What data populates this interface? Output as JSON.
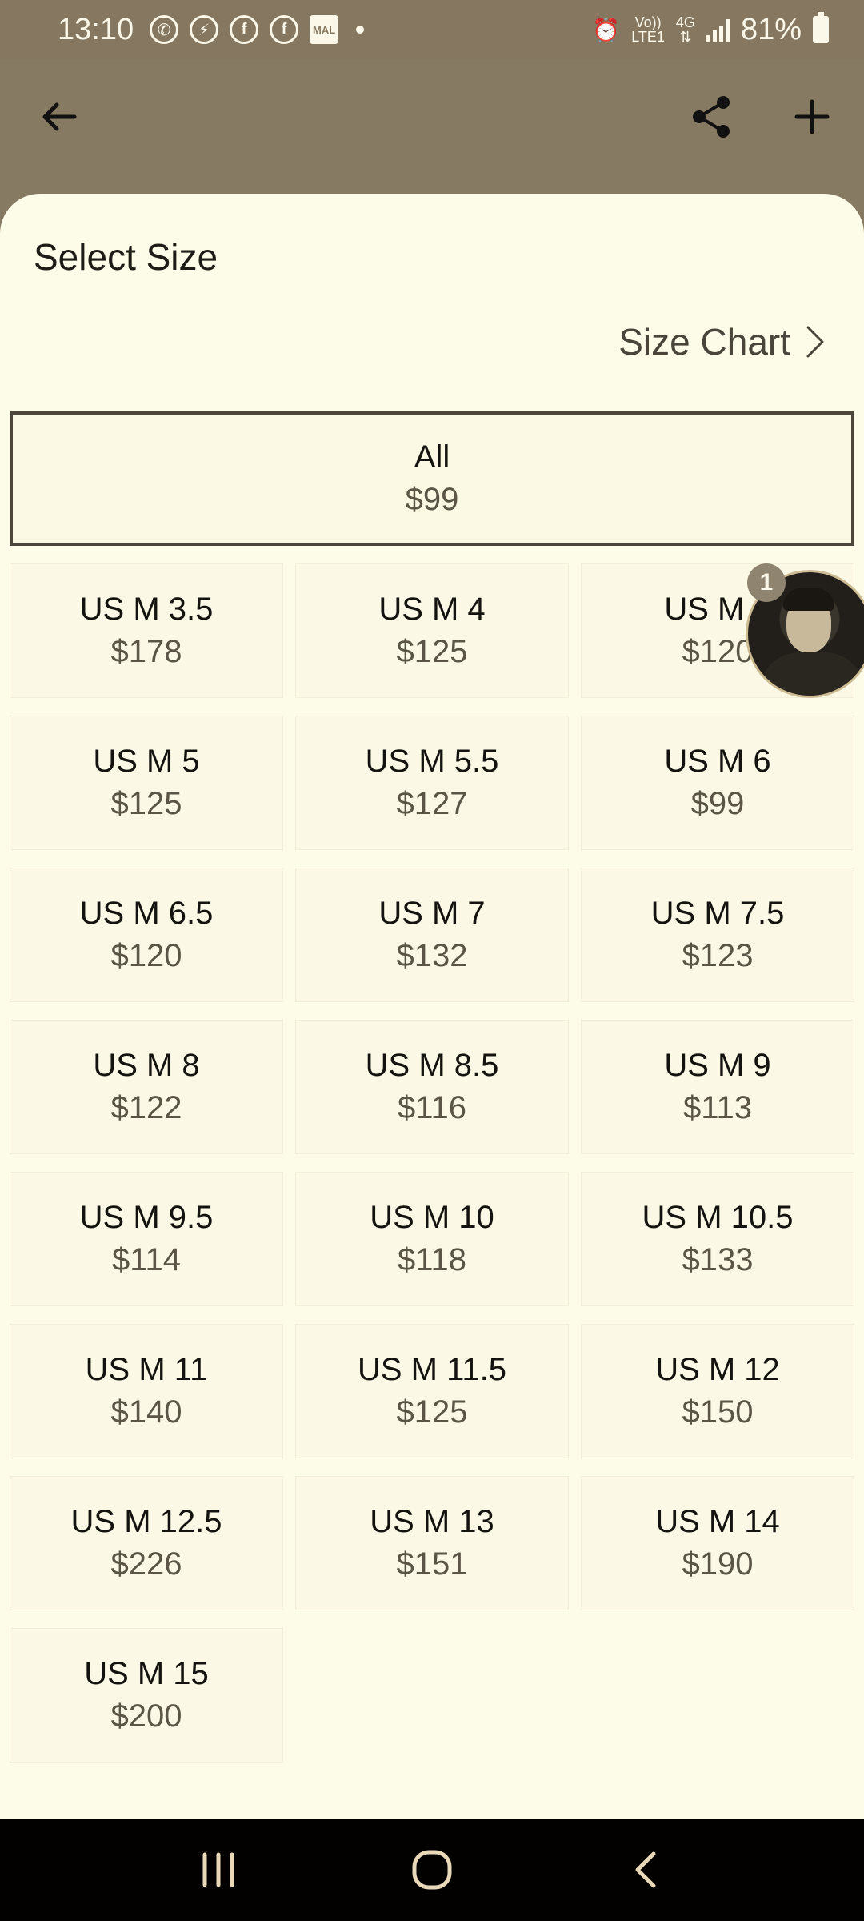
{
  "status_bar": {
    "time": "13:10",
    "notification_icons": [
      "whatsapp-icon",
      "messenger-icon",
      "facebook-icon",
      "facebook-icon",
      "mal-icon"
    ],
    "mal_label": "MAL",
    "network_volte": "Vo))",
    "network_lte": "LTE1",
    "network_type": "4G",
    "battery": "81%"
  },
  "header": {
    "back_icon": "arrow-left-icon",
    "share_icon": "share-icon",
    "add_icon": "plus-icon"
  },
  "sheet": {
    "title": "Select Size",
    "size_chart_label": "Size Chart",
    "all_option": {
      "size": "All",
      "price": "$99"
    },
    "sizes": [
      {
        "size": "US M 3.5",
        "price": "$178"
      },
      {
        "size": "US M 4",
        "price": "$125"
      },
      {
        "size": "US M 4",
        "price": "$120"
      },
      {
        "size": "US M 5",
        "price": "$125"
      },
      {
        "size": "US M 5.5",
        "price": "$127"
      },
      {
        "size": "US M 6",
        "price": "$99"
      },
      {
        "size": "US M 6.5",
        "price": "$120"
      },
      {
        "size": "US M 7",
        "price": "$132"
      },
      {
        "size": "US M 7.5",
        "price": "$123"
      },
      {
        "size": "US M 8",
        "price": "$122"
      },
      {
        "size": "US M 8.5",
        "price": "$116"
      },
      {
        "size": "US M 9",
        "price": "$113"
      },
      {
        "size": "US M 9.5",
        "price": "$114"
      },
      {
        "size": "US M 10",
        "price": "$118"
      },
      {
        "size": "US M 10.5",
        "price": "$133"
      },
      {
        "size": "US M 11",
        "price": "$140"
      },
      {
        "size": "US M 11.5",
        "price": "$125"
      },
      {
        "size": "US M 12",
        "price": "$150"
      },
      {
        "size": "US M 12.5",
        "price": "$226"
      },
      {
        "size": "US M 13",
        "price": "$151"
      },
      {
        "size": "US M 14",
        "price": "$190"
      },
      {
        "size": "US M 15",
        "price": "$200"
      }
    ]
  },
  "chat_head": {
    "badge_count": "1"
  },
  "colors": {
    "sheet_bg": "#fdfce8",
    "header_bg": "#877a62",
    "selected_border": "#4d473b",
    "price_text": "#5b5546"
  }
}
